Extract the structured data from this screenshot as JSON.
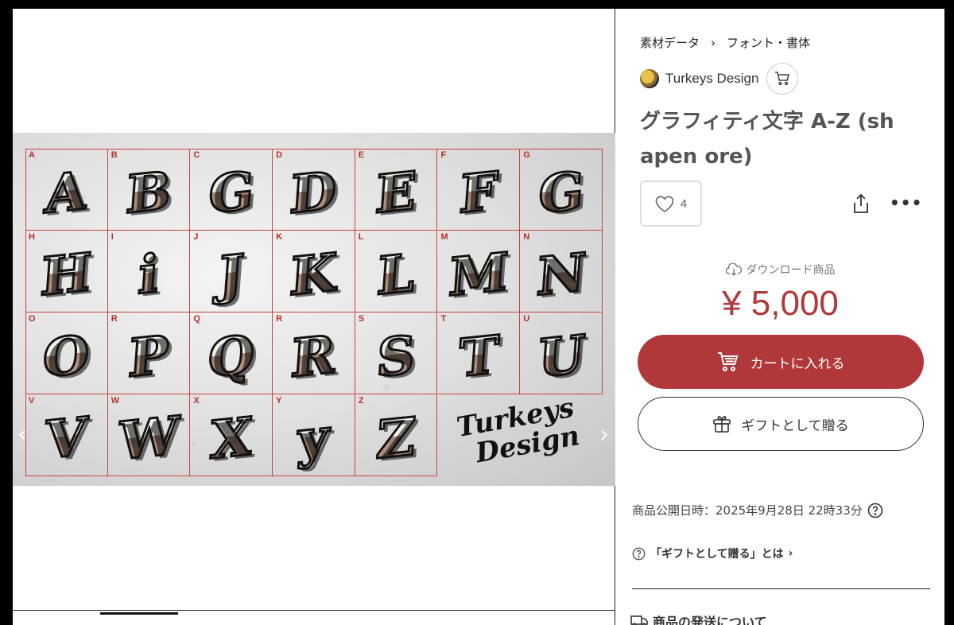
{
  "breadcrumb": {
    "items": [
      "素材データ",
      "フォント・書体"
    ],
    "separator": "›"
  },
  "shop": {
    "name": "Turkeys Design",
    "cart_icon": "shop-cart-icon"
  },
  "product": {
    "title": "グラフィティ文字 A-Z (shapen ore)",
    "title_line1": "グラフィティ文字 A-Z (sh",
    "title_line2": "apen ore)",
    "likes": "4",
    "download_label": "ダウンロード商品",
    "price": "¥ 5,000",
    "published": "商品公開日時：2025年9月28日 22時33分",
    "gift_help": "「ギフトとして贈る」とは",
    "shipping_heading": "商品の発送について"
  },
  "buttons": {
    "add_to_cart": "カートに入れる",
    "gift": "ギフトとして贈る"
  },
  "image": {
    "cells": [
      {
        "index": "A",
        "glyph": "A"
      },
      {
        "index": "B",
        "glyph": "B"
      },
      {
        "index": "C",
        "glyph": "G"
      },
      {
        "index": "D",
        "glyph": "D"
      },
      {
        "index": "E",
        "glyph": "E"
      },
      {
        "index": "F",
        "glyph": "F"
      },
      {
        "index": "G",
        "glyph": "G"
      },
      {
        "index": "H",
        "glyph": "H"
      },
      {
        "index": "I",
        "glyph": "i"
      },
      {
        "index": "J",
        "glyph": "J"
      },
      {
        "index": "K",
        "glyph": "K"
      },
      {
        "index": "L",
        "glyph": "L"
      },
      {
        "index": "M",
        "glyph": "M"
      },
      {
        "index": "N",
        "glyph": "N"
      },
      {
        "index": "O",
        "glyph": "O"
      },
      {
        "index": "R",
        "glyph": "P"
      },
      {
        "index": "Q",
        "glyph": "Q"
      },
      {
        "index": "R",
        "glyph": "R"
      },
      {
        "index": "S",
        "glyph": "S"
      },
      {
        "index": "T",
        "glyph": "T"
      },
      {
        "index": "U",
        "glyph": "U"
      },
      {
        "index": "V",
        "glyph": "V"
      },
      {
        "index": "W",
        "glyph": "W"
      },
      {
        "index": "X",
        "glyph": "X"
      },
      {
        "index": "Y",
        "glyph": "y"
      },
      {
        "index": "Z",
        "glyph": "Z"
      }
    ],
    "signature_line1": "Turkeys",
    "signature_line2": "Design"
  },
  "colors": {
    "accent": "#b0383a",
    "grid_line": "#c8453d",
    "letter_fill_top": "#f3f1ea",
    "letter_fill_bottom": "#a08272"
  },
  "icons": {
    "like": "heart-icon",
    "share": "share-icon",
    "more": "more-icon",
    "download": "cloud-download-icon",
    "cart": "cart-icon",
    "gift": "gift-icon",
    "help": "help-icon",
    "shipping": "truck-icon"
  }
}
